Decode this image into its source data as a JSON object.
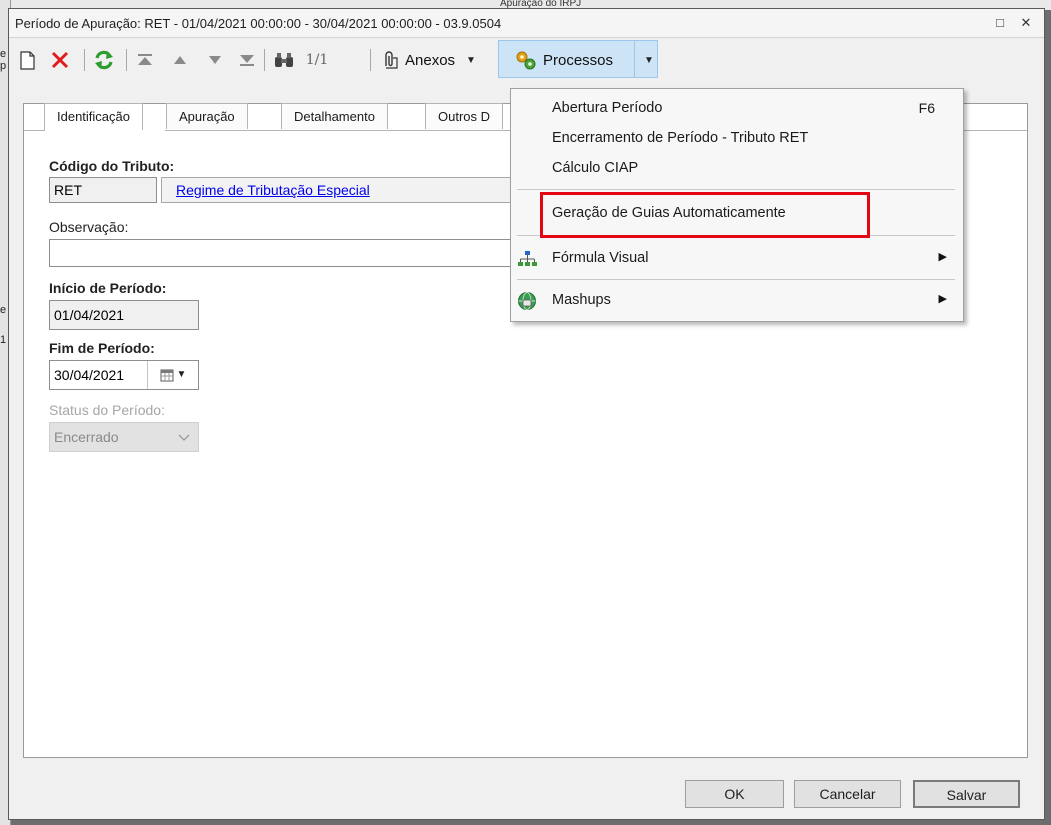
{
  "window": {
    "title": "Período de Apuração: RET - 01/04/2021 00:00:00 - 30/04/2021 00:00:00 - 03.9.0504",
    "restore_symbol": "□",
    "close_symbol": "✕"
  },
  "background": {
    "tab_text": "Apuração do IRPJ",
    "left_letters": [
      "e",
      "p",
      "e",
      "1"
    ]
  },
  "toolbar": {
    "page_indicator": "1/1",
    "anexos_label": "Anexos",
    "processos_label": "Processos",
    "caret": "▼",
    "icons": [
      "new-document-icon",
      "delete-icon",
      "refresh-icon",
      "first-record-icon",
      "previous-record-icon",
      "next-record-icon",
      "last-record-icon",
      "find-icon",
      "paperclip-icon",
      "process-gears-icon"
    ]
  },
  "tabs": [
    {
      "label": "Identificação",
      "active": true
    },
    {
      "label": "Apuração",
      "active": false
    },
    {
      "label": "Detalhamento",
      "active": false
    },
    {
      "label": "Outros D",
      "active": false
    }
  ],
  "form": {
    "codigo_label": "Código do Tributo:",
    "codigo_value": "RET",
    "codigo_link": "Regime de Tributação Especial",
    "observacao_label": "Observação:",
    "observacao_value": "",
    "inicio_label": "Início de Período:",
    "inicio_value": "01/04/2021",
    "fim_label": "Fim de Período:",
    "fim_value": "30/04/2021",
    "status_label": "Status do Período:",
    "status_value": "Encerrado"
  },
  "buttons": {
    "ok": "OK",
    "cancelar": "Cancelar",
    "salvar": "Salvar"
  },
  "menu": {
    "items": [
      {
        "label": "Abertura Período",
        "shortcut": "F6"
      },
      {
        "label": "Encerramento de Período - Tributo RET"
      },
      {
        "label": "Cálculo CIAP"
      },
      {
        "label": "Geração de Guias Automaticamente",
        "highlighted": true
      },
      {
        "label": "Fórmula Visual",
        "icon": "hierarchy-icon",
        "submenu": true
      },
      {
        "label": "Mashups",
        "icon": "globe-icon",
        "submenu": true
      }
    ],
    "submenu_arrow": "▶"
  },
  "colors": {
    "highlight": "#e30613",
    "link": "#0000ee",
    "delete_red": "#e01b1b",
    "refresh_green": "#2e9b2e",
    "menu_hover": "#cde4f7"
  }
}
